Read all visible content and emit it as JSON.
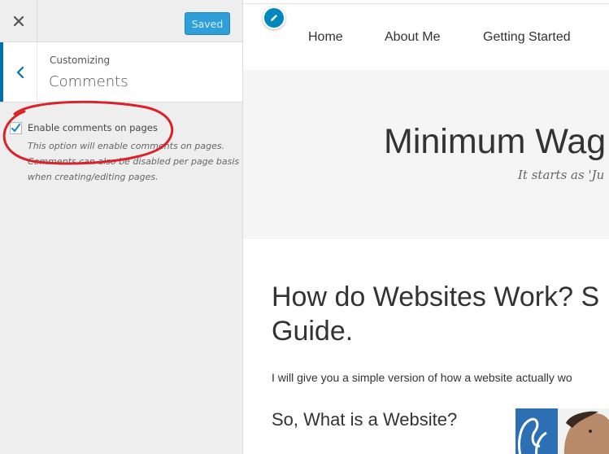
{
  "customizer": {
    "close_icon": "close-icon",
    "save_button": "Saved",
    "back_icon": "chevron-left-icon",
    "breadcrumb": "Customizing",
    "section_title": "Comments",
    "option": {
      "checked": true,
      "label": "Enable comments on pages",
      "description": "This option will enable comments on pages. Comments can also be disabled per page basis when creating/editing pages."
    },
    "annotation_color": "#d9232a"
  },
  "preview": {
    "edit_icon": "pencil-icon",
    "nav": [
      "Home",
      "About Me",
      "Getting Started"
    ],
    "site_title": "Minimum Wag",
    "tagline": "It starts as 'Ju",
    "post_title_line1": "How do Websites Work? S",
    "post_title_line2": "Guide.",
    "post_text": "I will give you a simple version of how a website actually wo",
    "post_subheading": "So, What is a Website?"
  },
  "colors": {
    "accent": "#0073aa",
    "button": "#2e9fd8",
    "panel_bg": "#eeeeee"
  }
}
